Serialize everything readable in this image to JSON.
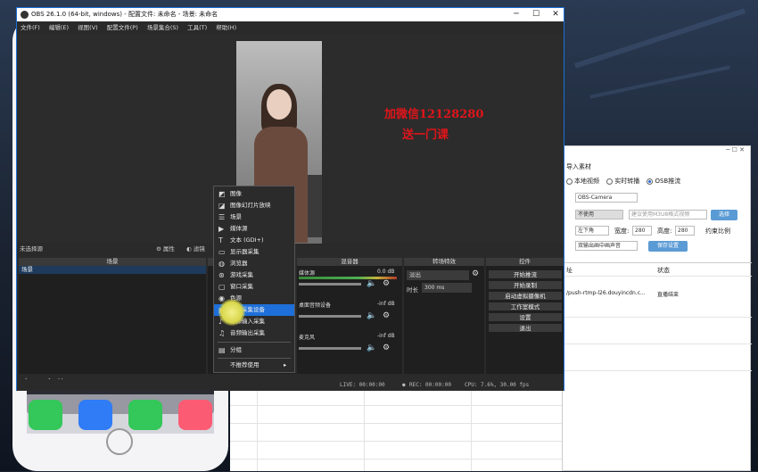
{
  "obs": {
    "title": "OBS 26.1.0 (64-bit, windows) - 配置文件: 未命名 - 场景: 未命名",
    "window_controls": [
      "─",
      "☐",
      "✕"
    ],
    "menu": [
      "文件(F)",
      "编辑(E)",
      "视图(V)",
      "配置文件(P)",
      "场景集合(S)",
      "工具(T)",
      "帮助(H)"
    ],
    "overlay_text": [
      "加微信12128280",
      "送一门课"
    ],
    "sources_status": "未选择源",
    "properties_label": "属性",
    "filters_label": "滤镜",
    "scenes": {
      "header": "场景",
      "items": [
        "场景"
      ]
    },
    "mixer": {
      "header": "混音器",
      "channels": [
        {
          "name": "媒体源",
          "level": "0.0 dB"
        },
        {
          "name": "桌面音频设备",
          "level": "-inf dB"
        },
        {
          "name": "麦克风",
          "level": "-inf dB"
        }
      ]
    },
    "transitions": {
      "header": "转场特效",
      "selected": "淡出",
      "duration_label": "时长",
      "duration_value": "300 ms"
    },
    "controls": {
      "header": "控件",
      "buttons": [
        "开始推流",
        "开始录制",
        "启动虚拟摄像机",
        "工作室模式",
        "设置",
        "退出"
      ]
    },
    "status": {
      "live": "LIVE: 00:00:00",
      "rec": "REC: 00:00:00",
      "cpu": "CPU: 7.6%, 30.00 fps"
    }
  },
  "context_menu": {
    "items": [
      {
        "icon": "image-icon",
        "glyph": "◩",
        "label": "图像"
      },
      {
        "icon": "slideshow-icon",
        "glyph": "◪",
        "label": "图像幻灯片放映"
      },
      {
        "icon": "scene-icon",
        "glyph": "☰",
        "label": "场景"
      },
      {
        "icon": "media-icon",
        "glyph": "▶",
        "label": "媒体源"
      },
      {
        "icon": "text-icon",
        "glyph": "T",
        "label": "文本 (GDI+)"
      },
      {
        "icon": "display-capture-icon",
        "glyph": "▭",
        "label": "显示器采集"
      },
      {
        "icon": "browser-icon",
        "glyph": "◍",
        "label": "浏览器"
      },
      {
        "icon": "game-capture-icon",
        "glyph": "⊛",
        "label": "游戏采集"
      },
      {
        "icon": "window-capture-icon",
        "glyph": "▢",
        "label": "窗口采集"
      },
      {
        "icon": "color-source-icon",
        "glyph": "◉",
        "label": "色源"
      },
      {
        "icon": "video-device-icon",
        "glyph": "▣",
        "label": "视频采集设备"
      },
      {
        "icon": "audio-input-icon",
        "glyph": "♪",
        "label": "音频输入采集"
      },
      {
        "icon": "audio-output-icon",
        "glyph": "♫",
        "label": "音频输出采集"
      },
      {
        "icon": "group-icon",
        "glyph": "▤",
        "label": "分组"
      },
      {
        "icon": "deprecated-icon",
        "glyph": "",
        "label": "不推荐使用"
      }
    ],
    "selected_index": 10
  },
  "bg_window": {
    "title_controls": "─ ☐ ✕",
    "import_label": "导入素材",
    "radio_options": [
      "本地视频",
      "实时转播",
      "OSB推流"
    ],
    "selected_radio": 2,
    "camera_value": "OBS-Camera",
    "unused_value": "不使用",
    "m3u_placeholder": "建议使用M3U8格式视频",
    "select_button": "选择",
    "position_value": "左下角",
    "width_label": "宽度:",
    "width_value": "280",
    "height_label": "高度:",
    "height_value": "280",
    "ratio_label": "约束比例",
    "audio_value": "双输出画中画声音",
    "save_button": "保存设置",
    "col_header_status": "状态",
    "col_header_addr": "址",
    "row_url": "/push-rtmp-l26.douyincdn.c...",
    "row_status": "直播结束"
  }
}
